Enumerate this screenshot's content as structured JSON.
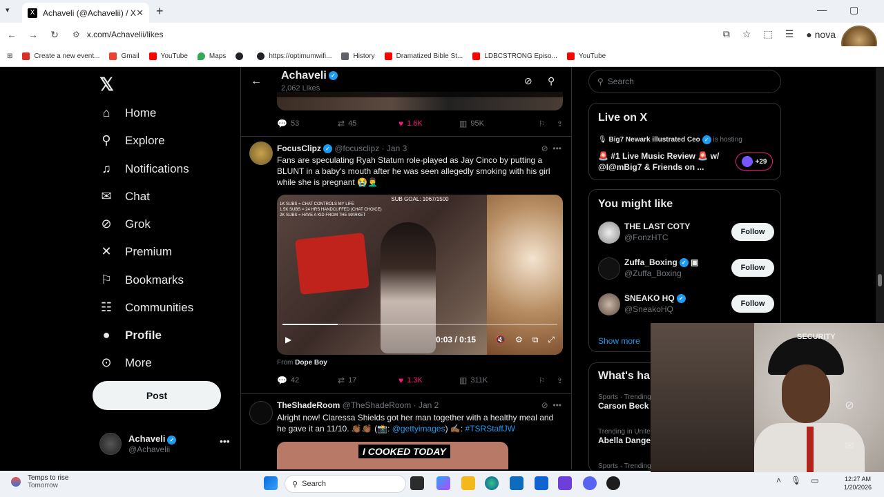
{
  "browser": {
    "tab_title": "Achaveli (@Achavelii) / X",
    "tab_favicon": "X",
    "tab_close": "✕",
    "new_tab": "+",
    "url": "x.com/Achavelii/likes",
    "profile_name": "nova",
    "bookmarks": [
      {
        "label": "Create a new event...",
        "color": "#d93025"
      },
      {
        "label": "Gmail",
        "color": "#ea4335"
      },
      {
        "label": "YouTube",
        "color": "#ff0000"
      },
      {
        "label": "Maps",
        "color": "#34a853"
      },
      {
        "label": "",
        "color": "#202124"
      },
      {
        "label": "https://optimumwifi...",
        "color": "#202124"
      },
      {
        "label": "History",
        "color": "#5f6368"
      },
      {
        "label": "Dramatized Bible St...",
        "color": "#ff0000"
      },
      {
        "label": "LDBCSTRONG Episo...",
        "color": "#ff0000"
      },
      {
        "label": "YouTube",
        "color": "#ff0000"
      }
    ]
  },
  "nav": {
    "items": [
      {
        "label": "Home",
        "icon": "home-icon"
      },
      {
        "label": "Explore",
        "icon": "search-icon"
      },
      {
        "label": "Notifications",
        "icon": "bell-icon"
      },
      {
        "label": "Chat",
        "icon": "mail-icon"
      },
      {
        "label": "Grok",
        "icon": "grok-icon"
      },
      {
        "label": "Premium",
        "icon": "x-icon"
      },
      {
        "label": "Bookmarks",
        "icon": "bookmark-icon"
      },
      {
        "label": "Communities",
        "icon": "people-icon"
      },
      {
        "label": "Profile",
        "icon": "person-icon"
      },
      {
        "label": "More",
        "icon": "more-circle-icon"
      }
    ],
    "post_label": "Post",
    "me_name": "Achaveli",
    "me_handle": "@Achavelii"
  },
  "feed": {
    "title": "Achaveli",
    "subtitle": "2,062 Likes",
    "top_actions": {
      "replies": "53",
      "reposts": "45",
      "likes": "1.6K",
      "views": "95K"
    },
    "post1": {
      "name": "FocusClipz",
      "handle": "@focusclipz",
      "date": "· Jan 3",
      "text": "Fans are speculating Ryah Statum role-played as Jay Cinco by putting a BLUNT in a baby's mouth after he was seen allegedly smoking with his girl while she is pregnant 😭🤦‍♂️",
      "video_goal": "SUB GOAL: 1067/1500",
      "video_subs": "1K SUBS = CHAT CONTROLS MY LIFE\n1.5K SUBS = 24 HRS HANDCUFFED (CHAT CHOICE)\n2K SUBS = HAVE A KID FROM THE MARKET",
      "video_time": "0:03 / 0:15",
      "video_progress": 0.2,
      "from_label": "From",
      "from_name": "Dope Boy",
      "actions": {
        "replies": "42",
        "reposts": "17",
        "likes": "1.3K",
        "views": "311K"
      }
    },
    "post2": {
      "name": "TheShadeRoom",
      "handle": "@TheShadeRoom",
      "date": "· Jan 2",
      "text_a": "Alright now! Claressa Shields got her man together with a healthy meal and he gave it an 11/10. 👏🏾👏🏾 (📸: ",
      "link1": "@gettyimages",
      "text_b": ") ✍🏾: ",
      "link2": "#TSRStaffJW",
      "media_caption": "I COOKED TODAY"
    }
  },
  "sidebar": {
    "search_placeholder": "Search",
    "live": {
      "title": "Live on X",
      "host_name": "Big7 Newark illustrated Ceo",
      "host_suffix": "is hosting",
      "space_title": "🚨 #1 Live Music Review 🚨 w/ @I@mBig7 & Friends on ...",
      "listeners": "+29"
    },
    "might_like": {
      "title": "You might like",
      "users": [
        {
          "name": "THE LAST COTY",
          "handle": "@FonzHTC",
          "follow": "Follow"
        },
        {
          "name": "Zuffa_Boxing",
          "handle": "@Zuffa_Boxing",
          "follow": "Follow"
        },
        {
          "name": "SNEAKO HQ",
          "handle": "@SneakoHQ",
          "follow": "Follow"
        }
      ],
      "show_more": "Show more"
    },
    "happening": {
      "title": "What's happening",
      "trends": [
        {
          "context": "Sports · Trending",
          "name": "Carson Beck"
        },
        {
          "context": "Trending in United States",
          "name": "Abella Danger"
        },
        {
          "context": "Sports · Trending",
          "name": ""
        }
      ]
    }
  },
  "webcam": {
    "cap_text": "SECURITY"
  },
  "taskbar": {
    "weather_title": "Temps to rise",
    "weather_sub": "Tomorrow",
    "search_label": "Search",
    "time": "12:27 AM",
    "date": "1/20/2026"
  }
}
